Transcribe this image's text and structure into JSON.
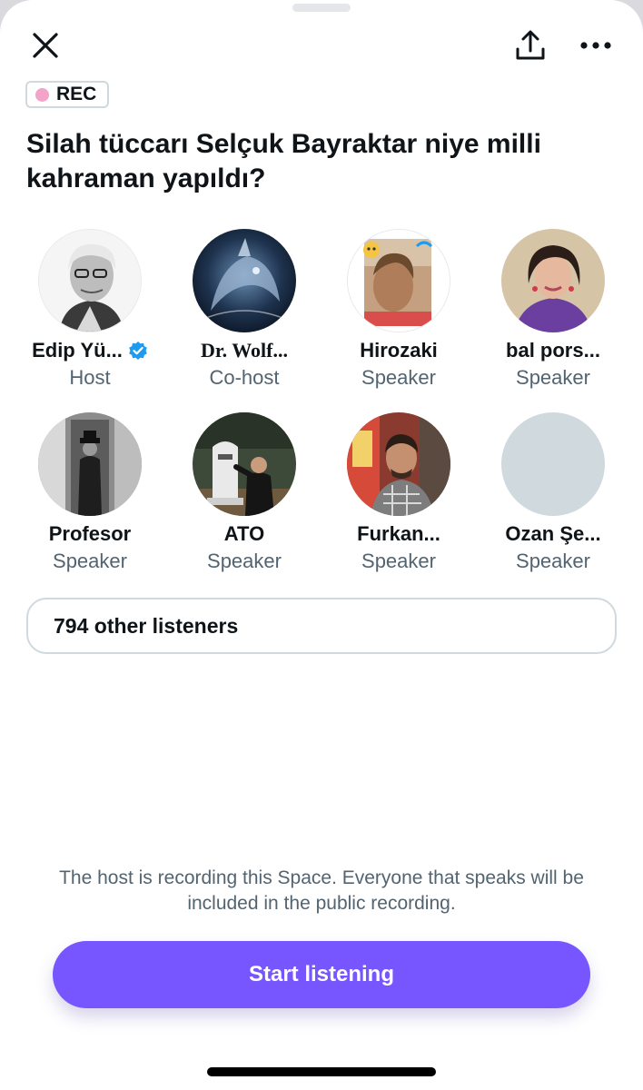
{
  "header": {
    "close_icon": "close-icon",
    "share_icon": "share-icon",
    "more_icon": "more-horizontal-icon"
  },
  "recording_badge": {
    "label": "REC",
    "dot_color": "#f4a4c8"
  },
  "space": {
    "title": "Silah tüccarı Selçuk Bayraktar niye milli kahraman yapıldı?"
  },
  "participants": [
    {
      "name": "Edip Yü...",
      "role": "Host",
      "verified": true
    },
    {
      "name": "Dr. Wolf...",
      "role": "Co-host",
      "verified": false
    },
    {
      "name": "Hirozaki",
      "role": "Speaker",
      "verified": false
    },
    {
      "name": "bal pors...",
      "role": "Speaker",
      "verified": false
    },
    {
      "name": "Profesor",
      "role": "Speaker",
      "verified": false
    },
    {
      "name": "ATO",
      "role": "Speaker",
      "verified": false
    },
    {
      "name": "Furkan...",
      "role": "Speaker",
      "verified": false
    },
    {
      "name": "Ozan Şe...",
      "role": "Speaker",
      "verified": false
    }
  ],
  "listeners": {
    "label": "794 other listeners"
  },
  "recording_notice": "The host is recording this Space. Everyone that speaks will be included in the public recording.",
  "actions": {
    "start_label": "Start listening"
  },
  "colors": {
    "accent": "#7856ff",
    "verified": "#1d9bf0",
    "secondary_text": "#536471",
    "border": "#cfd9de"
  }
}
